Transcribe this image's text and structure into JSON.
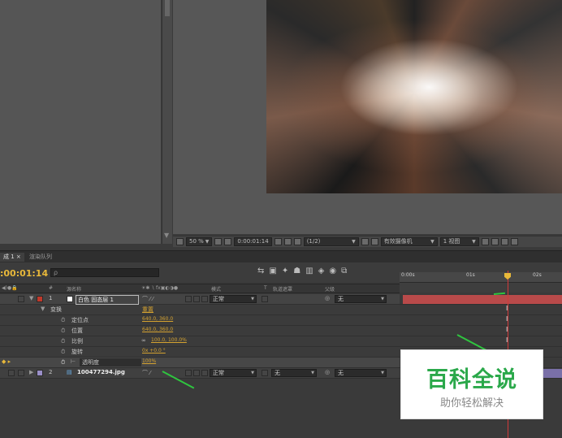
{
  "viewer": {
    "zoom": "50 %",
    "timecode": "0:00:01:14",
    "resolution": "(1/2)",
    "camera": "有效摄像机",
    "views": "1 视图"
  },
  "tabs": {
    "comp": "成 1 ×",
    "render": "渲染队列"
  },
  "timeline": {
    "timecode": ":00:01:14",
    "search_placeholder": "ρ",
    "ruler": [
      "0:00s",
      "01s",
      "02s"
    ],
    "columns": {
      "num": "#",
      "name": "源名称",
      "mode": "模式",
      "t": "T",
      "trkmat": "轨道遮罩",
      "parent": "父级"
    }
  },
  "layers": [
    {
      "num": "1",
      "name": "白色 固态层 1",
      "mode": "正常",
      "parent": "无",
      "color": "#c0392b"
    },
    {
      "num": "2",
      "name": "100477294.jpg",
      "mode": "正常",
      "trkmat": "无",
      "parent": "无",
      "color": "#9a8fc8"
    }
  ],
  "transform": {
    "label": "变换",
    "reset": "重置",
    "props": [
      {
        "label": "定位点",
        "value": "640.0, 360.0"
      },
      {
        "label": "位置",
        "value": "640.0, 360.0"
      },
      {
        "label": "比例",
        "value": "100.0, 100.0%"
      },
      {
        "label": "旋转",
        "value": "0x +0.0 °"
      },
      {
        "label": "透明度",
        "value": "100%"
      }
    ]
  },
  "watermark": {
    "title": "百科全说",
    "subtitle": "助你轻松解决"
  },
  "colors": {
    "timecode": "#e8b83a",
    "value": "#d4a230",
    "playhead": "#d13a3a",
    "arrow": "#2fc53f"
  }
}
